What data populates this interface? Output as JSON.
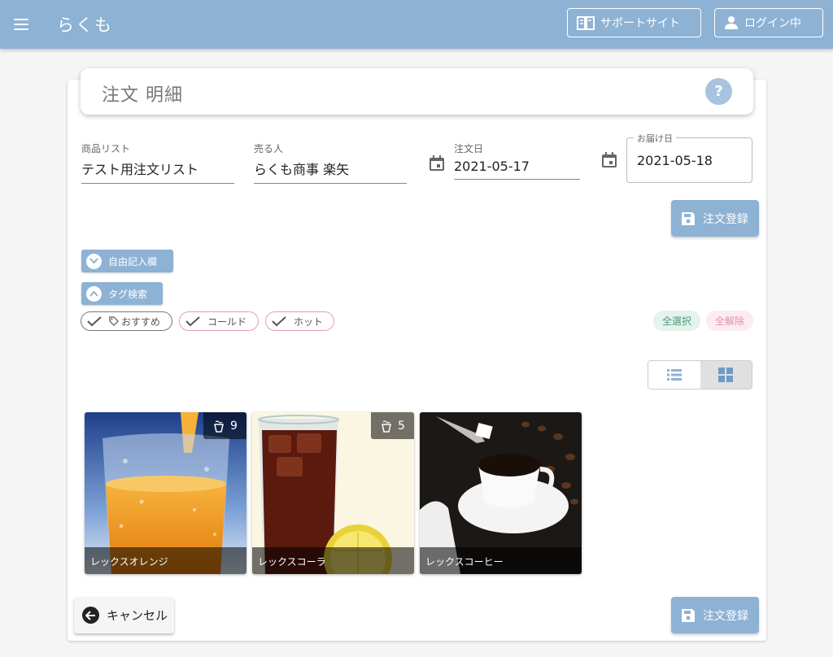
{
  "app": {
    "title": "らくも"
  },
  "header": {
    "support_label": "サポートサイト",
    "login_label": "ログイン中"
  },
  "page": {
    "title": "注文 明細",
    "help": "?"
  },
  "form": {
    "product_list": {
      "label": "商品リスト",
      "value": "テスト用注文リスト"
    },
    "seller": {
      "label": "売る人",
      "value": "らくも商事 楽矢"
    },
    "order_date": {
      "label": "注文日",
      "value": "2021-05-17"
    },
    "delivery_date": {
      "label": "お届け日",
      "value": "2021-05-18"
    }
  },
  "actions": {
    "register_label": "注文登録",
    "cancel_label": "キャンセル"
  },
  "sections": {
    "free_entry_label": "自由記入欄",
    "tag_search_label": "タグ検索"
  },
  "tags": [
    {
      "label": "おすすめ"
    },
    {
      "label": "コールド"
    },
    {
      "label": "ホット"
    }
  ],
  "tag_actions": {
    "select_all": "全選択",
    "clear_all": "全解除"
  },
  "products": [
    {
      "name": "レックスオレンジ",
      "count": "9"
    },
    {
      "name": "レックスコーラ",
      "count": "5"
    },
    {
      "name": "レックスコーヒー"
    }
  ],
  "colors": {
    "primary": "#8db2d4",
    "accent_green": "#4e9c7b",
    "accent_pink": "#e58fae"
  }
}
